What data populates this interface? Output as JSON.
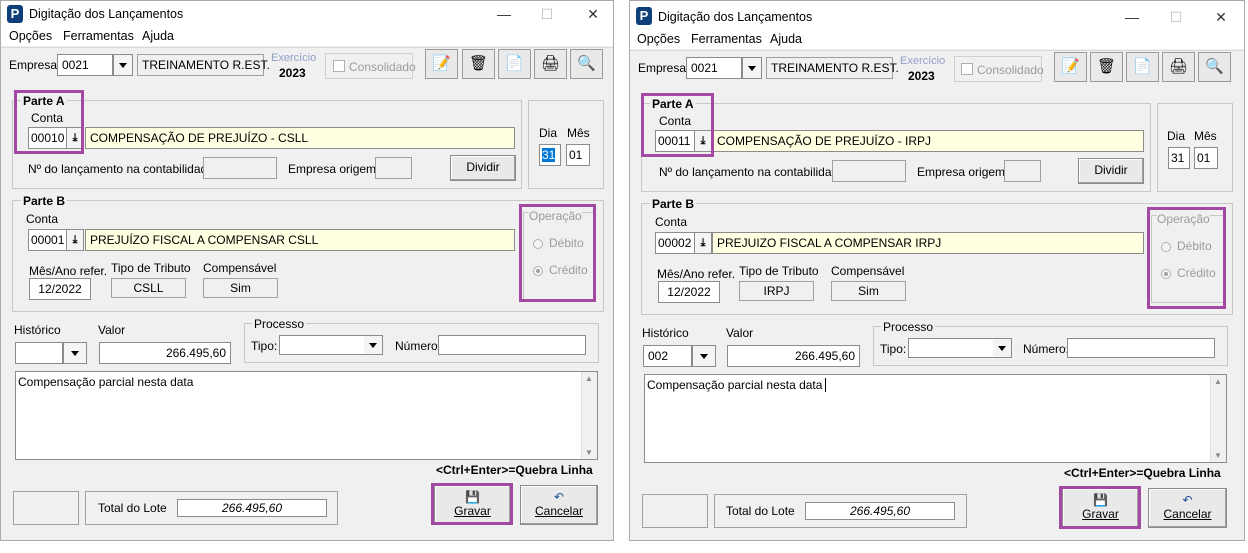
{
  "left": {
    "title": "Digitação dos Lançamentos",
    "menu": [
      "Opções",
      "Ferramentas",
      "Ajuda"
    ],
    "empresa_label": "Empresa:",
    "empresa_code": "0021",
    "empresa_name": "TREINAMENTO R.EST.",
    "exercicio_label": "Exercício",
    "exercicio_year": "2023",
    "consolidado_label": "Consolidado",
    "parte_a": {
      "title": "Parte A",
      "conta_label": "Conta",
      "conta_code": "00010",
      "conta_desc": "COMPENSAÇÃO DE PREJUÍZO - CSLL",
      "num_lanc_label": "Nº do lançamento na contabilidade:",
      "empresa_origem_label": "Empresa origem:",
      "dividir_label": "Dividir"
    },
    "dia_label": "Dia",
    "mes_label": "Mês",
    "dia_value": "31",
    "mes_value": "01",
    "parte_b": {
      "title": "Parte B",
      "conta_label": "Conta",
      "conta_code": "00001",
      "conta_desc": "PREJUÍZO FISCAL A COMPENSAR CSLL",
      "mes_ano_label": "Mês/Ano refer.",
      "mes_ano_value": "12/2022",
      "tipo_tributo_label": "Tipo de Tributo",
      "tipo_tributo_value": "CSLL",
      "compensavel_label": "Compensável",
      "compensavel_value": "Sim",
      "operacao_label": "Operação",
      "debito_label": "Débito",
      "credito_label": "Crédito"
    },
    "historico_label": "Histórico",
    "historico_value": "",
    "valor_label": "Valor",
    "valor_value": "266.495,60",
    "processo_label": "Processo",
    "tipo_label": "Tipo:",
    "numero_label": "Número:",
    "memo_text": "Compensação parcial nesta data",
    "shortcut_hint": "<Ctrl+Enter>=Quebra Linha",
    "total_label": "Total do Lote",
    "total_value": "266.495,60",
    "gravar_label": "Gravar",
    "cancelar_label": "Cancelar"
  },
  "right": {
    "title": "Digitação dos Lançamentos",
    "menu": [
      "Opções",
      "Ferramentas",
      "Ajuda"
    ],
    "empresa_label": "Empresa:",
    "empresa_code": "0021",
    "empresa_name": "TREINAMENTO R.EST.",
    "exercicio_label": "Exercício",
    "exercicio_year": "2023",
    "consolidado_label": "Consolidado",
    "parte_a": {
      "title": "Parte A",
      "conta_label": "Conta",
      "conta_code": "00011",
      "conta_desc": "COMPENSAÇÃO DE PREJUÍZO - IRPJ",
      "num_lanc_label": "Nº do lançamento na contabilidade:",
      "empresa_origem_label": "Empresa origem:",
      "dividir_label": "Dividir"
    },
    "dia_label": "Dia",
    "mes_label": "Mês",
    "dia_value": "31",
    "mes_value": "01",
    "parte_b": {
      "title": "Parte B",
      "conta_label": "Conta",
      "conta_code": "00002",
      "conta_desc": "PREJUIZO FISCAL A COMPENSAR IRPJ",
      "mes_ano_label": "Mês/Ano refer.",
      "mes_ano_value": "12/2022",
      "tipo_tributo_label": "Tipo de Tributo",
      "tipo_tributo_value": "IRPJ",
      "compensavel_label": "Compensável",
      "compensavel_value": "Sim",
      "operacao_label": "Operação",
      "debito_label": "Débito",
      "credito_label": "Crédito"
    },
    "historico_label": "Histórico",
    "historico_value": "002",
    "valor_label": "Valor",
    "valor_value": "266.495,60",
    "processo_label": "Processo",
    "tipo_label": "Tipo:",
    "numero_label": "Número:",
    "memo_text": "Compensação parcial nesta data",
    "shortcut_hint": "<Ctrl+Enter>=Quebra Linha",
    "total_label": "Total do Lote",
    "total_value": "266.495,60",
    "gravar_label": "Gravar",
    "cancelar_label": "Cancelar"
  },
  "icons": {
    "app_logo": "P",
    "minimize": "—",
    "maximize": "☐",
    "close": "✕",
    "toolbar": [
      "document-edit-icon",
      "recycle-bin-icon",
      "report-icon",
      "printer-icon",
      "preview-icon"
    ],
    "gravar": "save-icon",
    "cancelar": "undo-icon"
  },
  "colors": {
    "highlight": "#a349a4",
    "yellow_field": "#ffffe1",
    "exercicio_label": "#8f9fc8"
  }
}
